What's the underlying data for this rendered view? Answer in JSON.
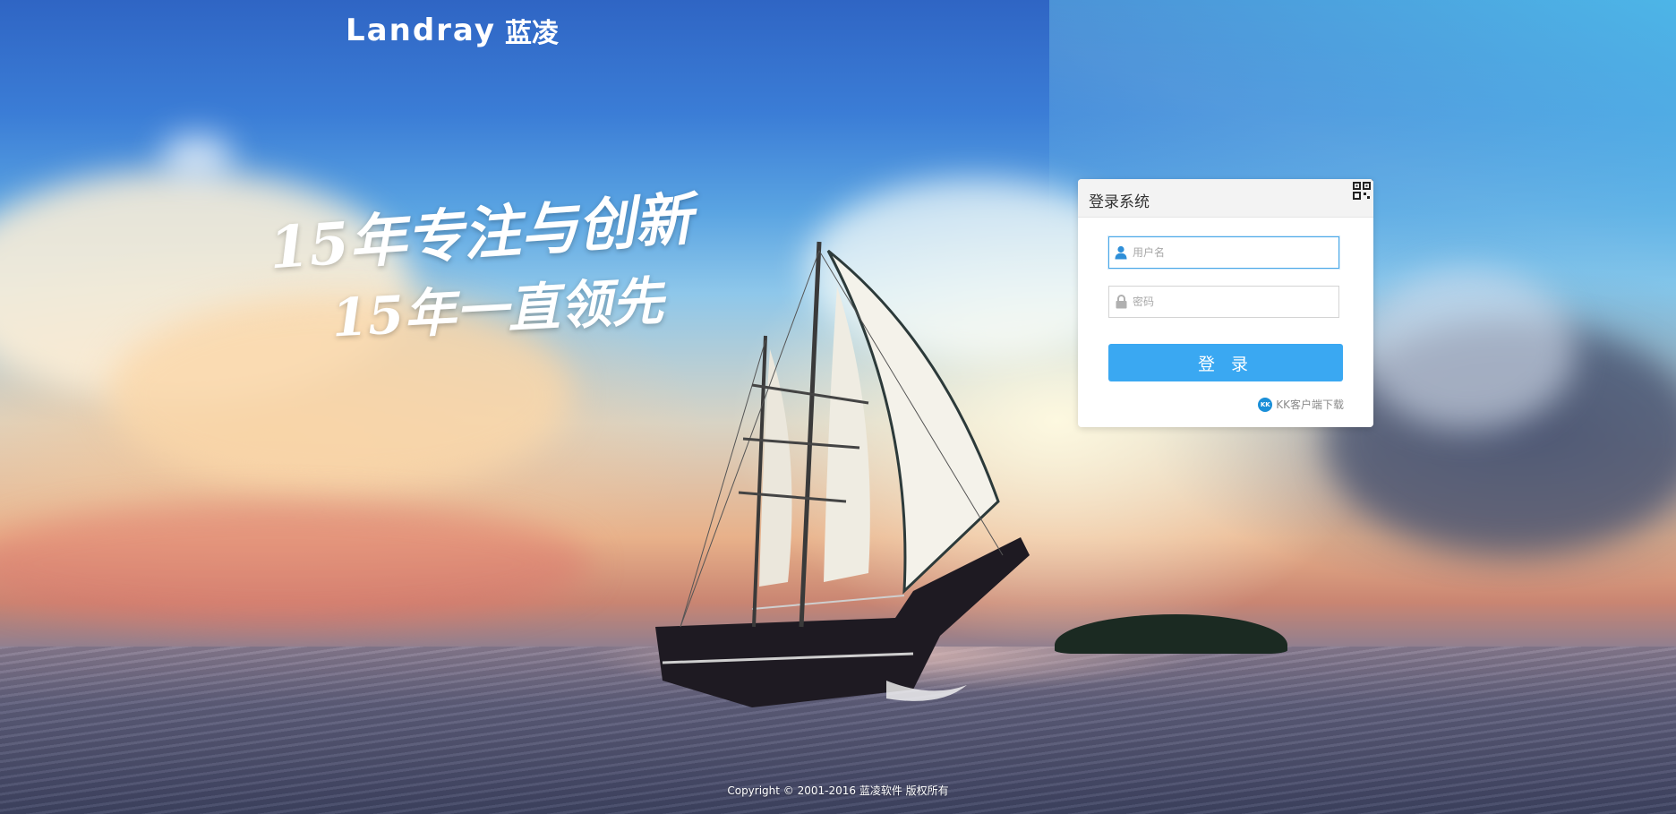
{
  "brand": {
    "logo_text": "Landray",
    "logo_cn": "蓝凌"
  },
  "slogan": {
    "line1": "15年专注与创新",
    "line2": "15年一直领先"
  },
  "login": {
    "title": "登录系统",
    "username_placeholder": "用户名",
    "password_placeholder": "密码",
    "submit_label": "登 录",
    "kk_download": "KK客户端下载",
    "kk_icon_text": "KK"
  },
  "footer": {
    "copyright": "Copyright © 2001-2016 蓝凌软件 版权所有"
  },
  "colors": {
    "accent": "#3aa8f2",
    "focus_border": "#4aa8e8",
    "kk_icon": "#1a8fd8"
  },
  "icons": {
    "qr": "qr-code-icon",
    "user": "user-icon",
    "lock": "lock-icon",
    "kk": "kk-client-icon"
  }
}
